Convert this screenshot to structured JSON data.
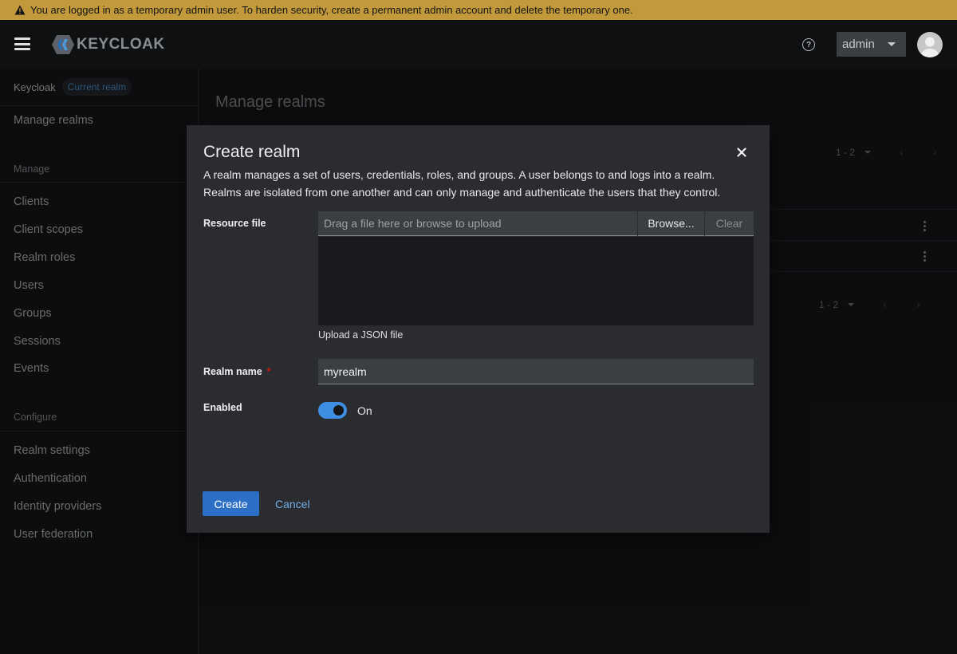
{
  "banner": {
    "text": "You are logged in as a temporary admin user. To harden security, create a permanent admin account and delete the temporary one.",
    "color": "#c29a3b"
  },
  "masthead": {
    "logo_text": "KEYCLOAK",
    "user_name": "admin"
  },
  "sidebar": {
    "breadcrumb": "Keycloak",
    "realm_badge": "Current realm",
    "manage_realms": "Manage realms",
    "manage_section": "Manage",
    "manage_items": [
      "Clients",
      "Client scopes",
      "Realm roles",
      "Users",
      "Groups",
      "Sessions",
      "Events"
    ],
    "configure_section": "Configure",
    "configure_items": [
      "Realm settings",
      "Authentication",
      "Identity providers",
      "User federation"
    ]
  },
  "main": {
    "title": "Manage realms",
    "pagination_top": "1 - 2",
    "pagination_bottom": "1 - 2"
  },
  "modal": {
    "title": "Create realm",
    "description_line1": "A realm manages a set of users, credentials, roles, and groups. A user belongs to and logs into a realm.",
    "description_line2": "Realms are isolated from one another and can only manage and authenticate the users that they control.",
    "resource_file_label": "Resource file",
    "file_placeholder": "Drag a file here or browse to upload",
    "browse_label": "Browse...",
    "clear_label": "Clear",
    "helper_text": "Upload a JSON file",
    "realm_name_label": "Realm name",
    "required_mark": "*",
    "realm_name_value": "myrealm",
    "enabled_label": "Enabled",
    "enabled_state": "On",
    "create_label": "Create",
    "cancel_label": "Cancel",
    "accent_color": "#2b6fc7",
    "toggle_color": "#3e8ee3"
  }
}
